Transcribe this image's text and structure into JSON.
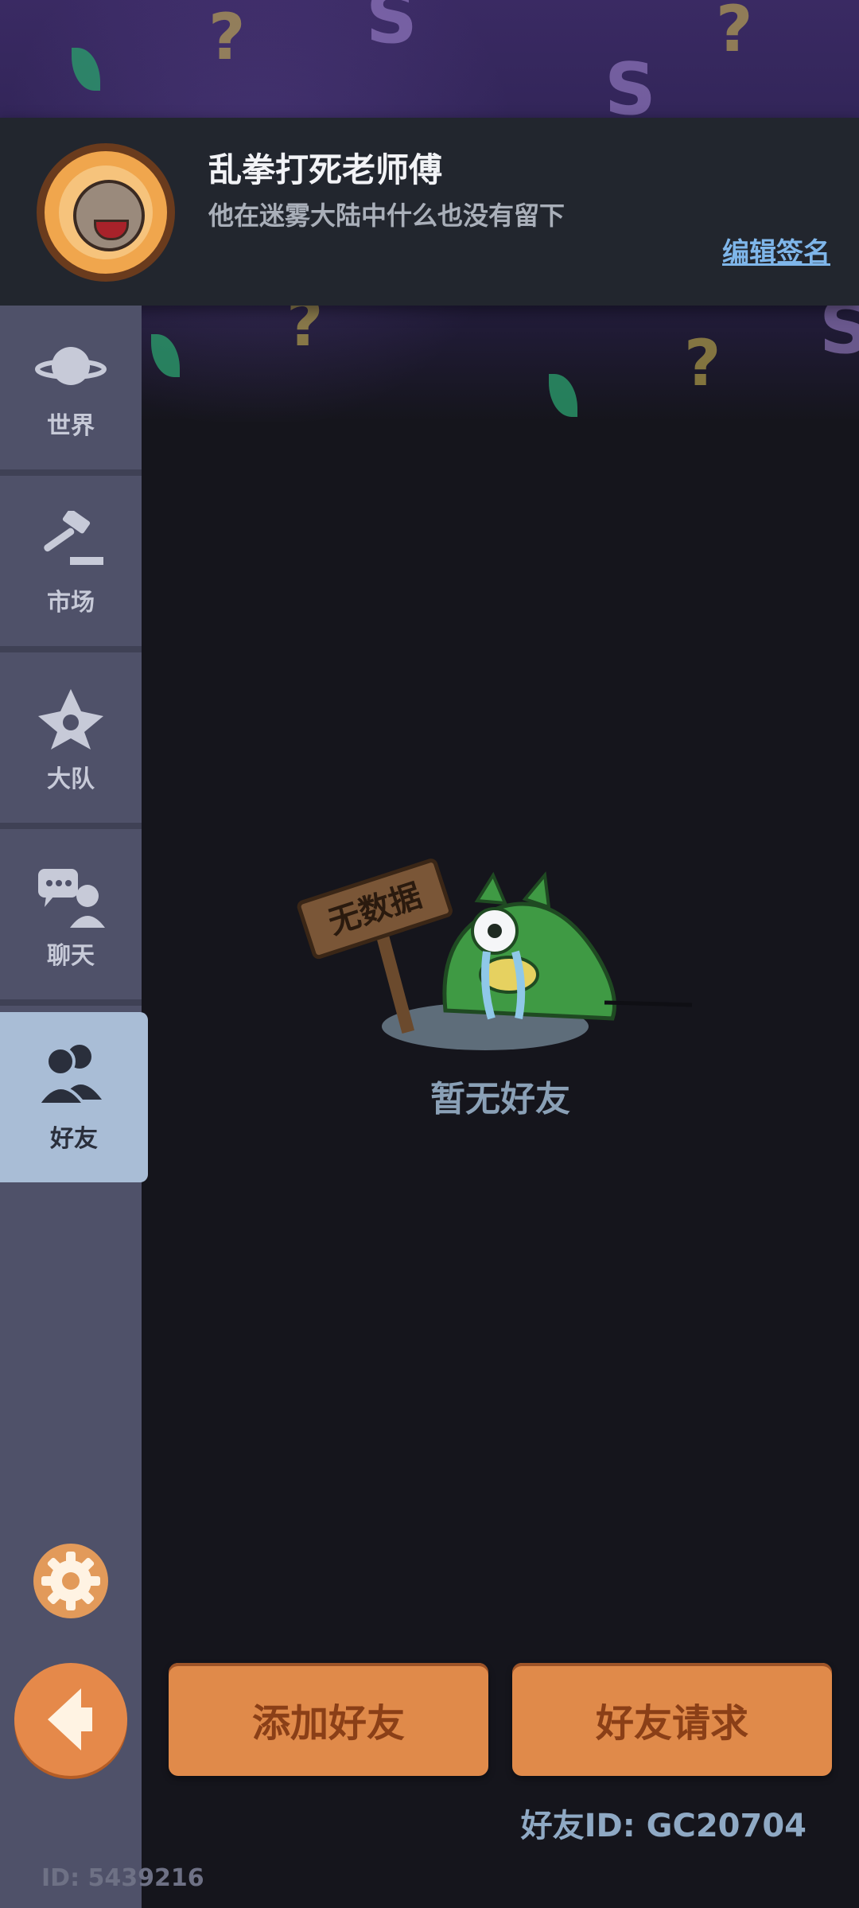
{
  "profile": {
    "name": "乱拳打死老师傅",
    "signature": "他在迷雾大陆中什么也没有留下",
    "edit_signature_label": "编辑签名"
  },
  "sidebar": {
    "items": [
      {
        "label": "世界",
        "icon": "planet-icon"
      },
      {
        "label": "市场",
        "icon": "gavel-icon"
      },
      {
        "label": "大队",
        "icon": "guild-emblem-icon"
      },
      {
        "label": "聊天",
        "icon": "chat-icon"
      },
      {
        "label": "好友",
        "icon": "friends-icon",
        "active": true
      }
    ],
    "settings_icon": "gear-icon",
    "back_icon": "back-arrow-icon",
    "user_id_text": "ID: 5439216"
  },
  "empty_state": {
    "sign_text": "无数据",
    "message": "暂无好友"
  },
  "actions": {
    "add_friend_label": "添加好友",
    "friend_requests_label": "好友请求"
  },
  "friend_id_text": "好友ID: GC20704",
  "colors": {
    "accent_orange": "#e08a4a",
    "sidebar_bg": "#4f5169",
    "active_tab": "#a9bdd6",
    "link_blue": "#7fb6ea"
  }
}
